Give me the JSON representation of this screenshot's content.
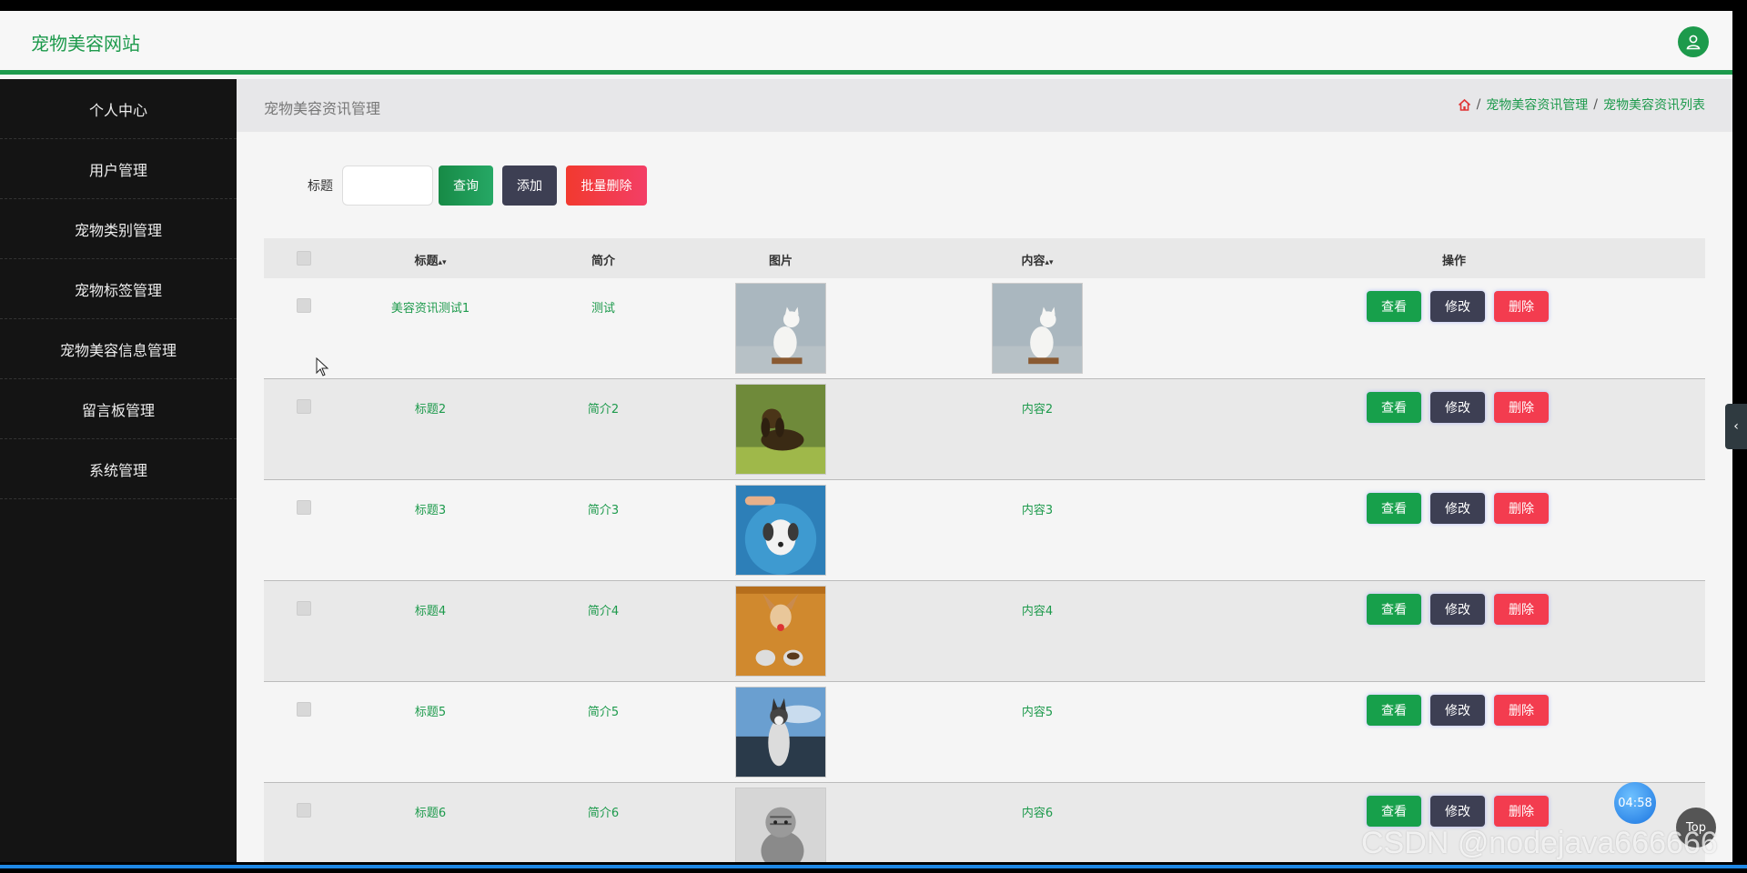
{
  "header": {
    "brand": "宠物美容网站"
  },
  "sidebar": {
    "items": [
      {
        "label": "个人中心"
      },
      {
        "label": "用户管理"
      },
      {
        "label": "宠物类别管理"
      },
      {
        "label": "宠物标签管理"
      },
      {
        "label": "宠物美容信息管理"
      },
      {
        "label": "留言板管理"
      },
      {
        "label": "系统管理"
      }
    ]
  },
  "page": {
    "title": "宠物美容资讯管理",
    "breadcrumb": [
      {
        "label": "宠物美容资讯管理"
      },
      {
        "label": "宠物美容资讯列表"
      }
    ],
    "separator": "/"
  },
  "search": {
    "label": "标题",
    "value": "",
    "query_label": "查询",
    "add_label": "添加",
    "batch_delete_label": "批量删除"
  },
  "table": {
    "columns": {
      "title": "标题",
      "brief": "简介",
      "image": "图片",
      "content": "内容",
      "ops": "操作"
    },
    "ops": {
      "view": "查看",
      "edit": "修改",
      "delete": "删除"
    },
    "rows": [
      {
        "title": "美容资讯测试1",
        "brief": "测试",
        "image": "white-cat-photo",
        "content": "",
        "content_image": "white-cat-photo"
      },
      {
        "title": "标题2",
        "brief": "简介2",
        "image": "dachshund-photo",
        "content": "内容2"
      },
      {
        "title": "标题3",
        "brief": "简介3",
        "image": "puppy-bath-photo",
        "content": "内容3"
      },
      {
        "title": "标题4",
        "brief": "简介4",
        "image": "dog-with-bowls-photo",
        "content": "内容4"
      },
      {
        "title": "标题5",
        "brief": "简介5",
        "image": "husky-photo",
        "content": "内容5"
      },
      {
        "title": "标题6",
        "brief": "简介6",
        "image": "tabby-cat-photo",
        "content": "内容6"
      }
    ]
  },
  "overlay": {
    "timer": "04:58",
    "top_label": "Top",
    "watermark": "CSDN @nodejava666666"
  },
  "colors": {
    "accent": "#1d9a4c",
    "sidebar_bg": "#141414",
    "edit_btn": "#3d3f53",
    "delete_btn": "#f33c4f"
  }
}
